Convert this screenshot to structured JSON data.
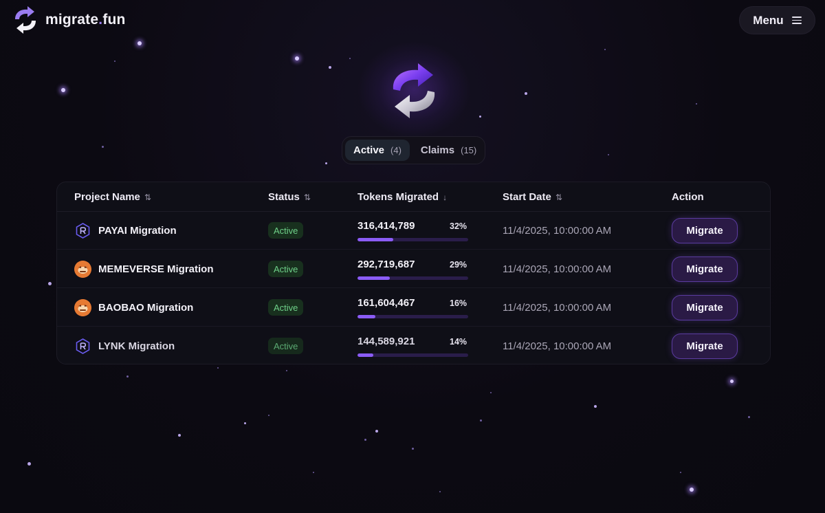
{
  "header": {
    "logo_text_main": "migrate",
    "logo_text_dot": ".",
    "logo_text_tld": "fun",
    "logo_icon": "refresh-arrows-icon",
    "menu_label": "Menu",
    "menu_icon": "hamburger-icon"
  },
  "hero": {
    "emblem_icon": "swap-arrows-3d-icon"
  },
  "tabs": [
    {
      "label": "Active",
      "count": "(4)",
      "selected": true
    },
    {
      "label": "Claims",
      "count": "(15)",
      "selected": false
    }
  ],
  "table": {
    "columns": [
      {
        "label": "Project Name",
        "sort_icon": "⇅"
      },
      {
        "label": "Status",
        "sort_icon": "⇅"
      },
      {
        "label": "Tokens Migrated",
        "sort_icon": "↓"
      },
      {
        "label": "Start Date",
        "sort_icon": "⇅"
      },
      {
        "label": "Action",
        "sort_icon": ""
      }
    ],
    "rows": [
      {
        "name": "PAYAI Migration",
        "icon": "raydium-icon",
        "status": "Active",
        "tokens": "316,414,789",
        "percent": "32%",
        "progress": 0.32,
        "start": "11/4/2025, 10:00:00 AM",
        "action": "Migrate"
      },
      {
        "name": "MEMEVERSE Migration",
        "icon": "memeverse-avatar",
        "status": "Active",
        "tokens": "292,719,687",
        "percent": "29%",
        "progress": 0.29,
        "start": "11/4/2025, 10:00:00 AM",
        "action": "Migrate"
      },
      {
        "name": "BAOBAO Migration",
        "icon": "baobao-avatar",
        "status": "Active",
        "tokens": "161,604,467",
        "percent": "16%",
        "progress": 0.16,
        "start": "11/4/2025, 10:00:00 AM",
        "action": "Migrate"
      },
      {
        "name": "LYNK Migration",
        "icon": "raydium-icon",
        "status": "Active",
        "tokens": "144,589,921",
        "percent": "14%",
        "progress": 0.14,
        "start": "11/4/2025, 10:00:00 AM",
        "action": "Migrate"
      }
    ]
  },
  "colors": {
    "background": "#0c0a12",
    "accent": "#8b5cf6",
    "status_green": "#6fd28a",
    "button_border": "#5b3ba0"
  }
}
